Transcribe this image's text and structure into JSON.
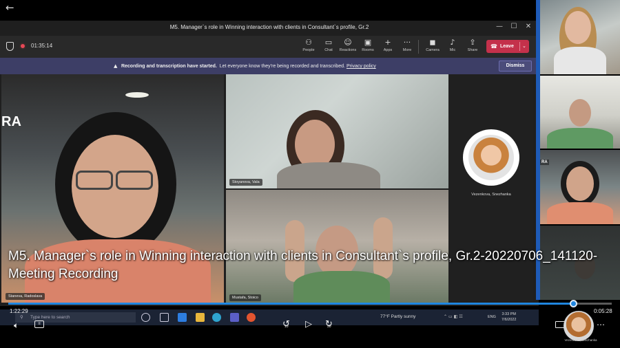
{
  "window": {
    "title": "M5. Manager`s role in Winning interaction with clients in Consultant`s profile, Gr.2",
    "controls": {
      "minimize": "—",
      "maximize": "☐",
      "close": "✕"
    }
  },
  "toolbar": {
    "elapsed": "01:35:14",
    "buttons": [
      {
        "label": "People",
        "icon": "people-icon",
        "glyph": "⚇"
      },
      {
        "label": "Chat",
        "icon": "chat-icon",
        "glyph": "▭"
      },
      {
        "label": "Reactions",
        "icon": "reactions-icon",
        "glyph": "☺"
      },
      {
        "label": "Rooms",
        "icon": "rooms-icon",
        "glyph": "▣"
      },
      {
        "label": "Apps",
        "icon": "apps-icon",
        "glyph": "+"
      },
      {
        "label": "More",
        "icon": "more-icon",
        "glyph": "···"
      },
      {
        "label": "Camera",
        "icon": "camera-icon",
        "glyph": "◼"
      },
      {
        "label": "Mic",
        "icon": "mic-icon",
        "glyph": "♪"
      },
      {
        "label": "Share",
        "icon": "share-icon",
        "glyph": "⇪"
      }
    ],
    "leave_label": "Leave",
    "leave_color": "#c4314b"
  },
  "banner": {
    "bold_text": "Recording and transcription have started.",
    "text": "Let everyone know they're being recorded and transcribed.",
    "link": "Privacy policy",
    "dismiss": "Dismiss",
    "background": "#3d3e66"
  },
  "participants": {
    "main": "Staneva, Radoslava",
    "top_center": "Stoyanova, Vala",
    "bottom_center": "Mustafa, Stoico",
    "avatar_name": "Vezenkova, Snezhanka"
  },
  "strip": {
    "tag": "RA"
  },
  "main_tile_tag": "RA",
  "taskbar": {
    "search_placeholder": "Type here to search",
    "weather": "77°F  Partly sunny",
    "lang": "ENG",
    "time": "3:33 PM",
    "date": "7/6/2022"
  },
  "video": {
    "caption": "M5. Manager`s role in Winning interaction with clients in Consultant`s profile, Gr.2-20220706_141120-Meeting Recording",
    "current_time": "1:22:29",
    "remaining_time": "0:05:28",
    "progress_percent": 93.6,
    "accent": "#1f86e0",
    "rewind_seconds": "10",
    "forward_seconds": "30",
    "mini_cam_name": "Vezenkova, Snezhanka"
  }
}
